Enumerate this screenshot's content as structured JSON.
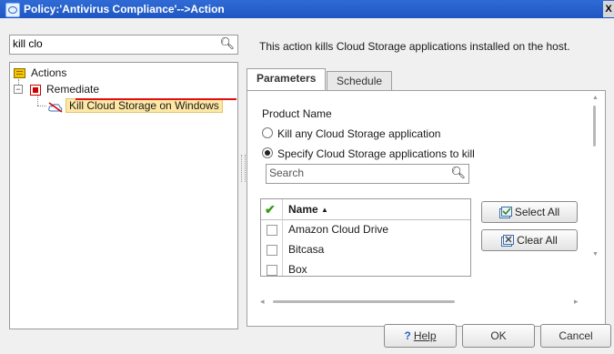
{
  "window": {
    "title": "Policy:'Antivirus Compliance'-->Action",
    "close_glyph": "X"
  },
  "left": {
    "search_value": "kill clo",
    "tree": {
      "root": "Actions",
      "group": "Remediate",
      "item": "Kill Cloud Storage on Windows"
    }
  },
  "description": "This action kills Cloud Storage applications installed on the host.",
  "tabs": [
    {
      "label": "Parameters",
      "active": true
    },
    {
      "label": "Schedule",
      "active": false
    }
  ],
  "parameters": {
    "product_name_label": "Product Name",
    "radio_any": "Kill any Cloud Storage application",
    "radio_specify": "Specify Cloud Storage applications to kill",
    "selected_radio": "specify",
    "search_placeholder": "Search",
    "table": {
      "column_name": "Name",
      "rows": [
        "Amazon Cloud Drive",
        "Bitcasa",
        "Box"
      ]
    },
    "select_all": "Select All",
    "clear_all": "Clear All"
  },
  "footer": {
    "help": "Help",
    "ok": "OK",
    "cancel": "Cancel"
  },
  "colors": {
    "titlebar": "#2f6bd6",
    "selection": "#fde7a4",
    "underline": "#e01010"
  }
}
